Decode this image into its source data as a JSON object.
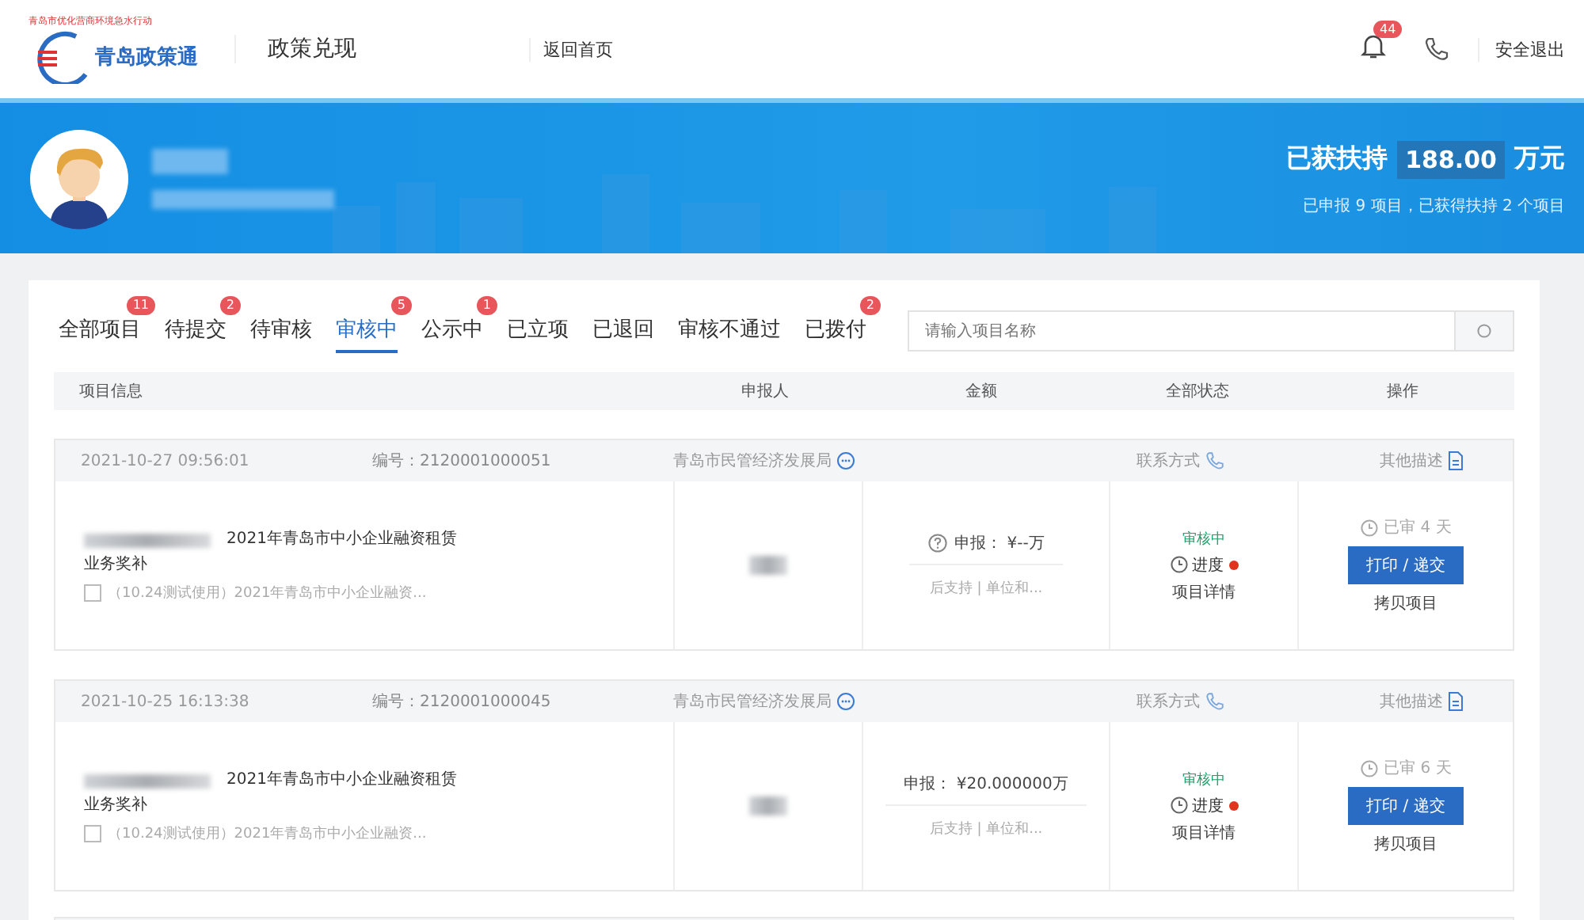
{
  "header": {
    "slogan": "青岛市优化营商环境急水行动",
    "logo_text": "青岛政策通",
    "title": "政策兑现",
    "home_link": "返回首页",
    "notification_count": "44",
    "logout": "安全退出"
  },
  "banner": {
    "support_label": "已获扶持",
    "support_amount": "188.00",
    "support_unit": "万元",
    "summary": "已申报 9 项目，已获得扶持 2 个项目"
  },
  "tabs": [
    {
      "label": "全部项目",
      "badge": "11",
      "selected": false
    },
    {
      "label": "待提交",
      "badge": "2",
      "selected": false
    },
    {
      "label": "待审核",
      "selected": false
    },
    {
      "label": "审核中",
      "badge": "5",
      "selected": true
    },
    {
      "label": "公示中",
      "badge": "1",
      "selected": false
    },
    {
      "label": "已立项",
      "selected": false
    },
    {
      "label": "已退回",
      "selected": false
    },
    {
      "label": "审核不通过",
      "selected": false
    },
    {
      "label": "已拨付",
      "badge": "2",
      "selected": false
    }
  ],
  "search": {
    "placeholder": "请输入项目名称"
  },
  "table": {
    "columns": [
      "项目信息",
      "申报人",
      "金额",
      "全部状态",
      "操作"
    ],
    "rows": [
      {
        "date": "2021-10-27 09:56:01",
        "number": "编号：2120001000051",
        "department": "青岛市民管经济发展局",
        "contact": "联系方式",
        "other": "其他描述",
        "title": "2021年青岛市中小企业融资租赁业务奖补",
        "subtitle": "（10.24测试使用）2021年青岛市中小企业融资...",
        "amount": "申报： ¥--万",
        "amount_hint": true,
        "amount_note": "后支持 | 单位和...",
        "status": "审核中",
        "progress": "进度",
        "detail": "项目详情",
        "elapsed": "已审 4 天",
        "action": "打印 / 递交",
        "copy": "拷贝项目"
      },
      {
        "date": "2021-10-25 16:13:38",
        "number": "编号：2120001000045",
        "department": "青岛市民管经济发展局",
        "contact": "联系方式",
        "other": "其他描述",
        "title": "2021年青岛市中小企业融资租赁业务奖补",
        "subtitle": "（10.24测试使用）2021年青岛市中小企业融资...",
        "amount": "申报： ¥20.000000万",
        "amount_hint": false,
        "amount_note": "后支持 | 单位和...",
        "status": "审核中",
        "progress": "进度",
        "detail": "项目详情",
        "elapsed": "已审 6 天",
        "action": "打印 / 递交",
        "copy": "拷贝项目"
      }
    ]
  }
}
